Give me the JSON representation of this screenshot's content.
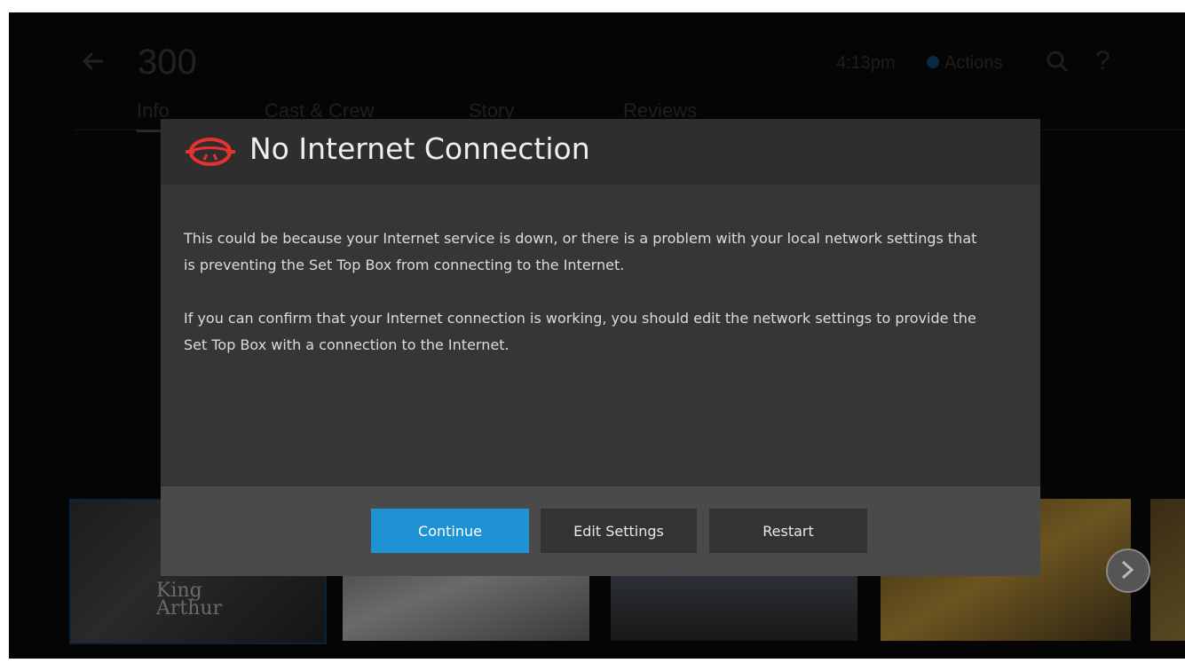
{
  "background": {
    "title": "300",
    "time": "4:13pm",
    "actions_label": "Actions",
    "tabs": [
      {
        "label": "Info",
        "active": true
      },
      {
        "label": "Cast & Crew",
        "active": false
      },
      {
        "label": "Story",
        "active": false
      },
      {
        "label": "Reviews",
        "active": false
      }
    ],
    "tile_1_text_line1": "King",
    "tile_1_text_line2": "Arthur",
    "icons": [
      "back-arrow-icon",
      "search-icon",
      "help-icon",
      "chevron-right-icon"
    ]
  },
  "dialog": {
    "title": "No Internet Connection",
    "icon": "disconnected-globe-icon",
    "icon_color": "#e8312e",
    "paragraphs": [
      "This could be because your Internet service is down, or there is a problem with your local network settings that is preventing the Set Top Box from connecting to the Internet.",
      "If you can confirm that your Internet connection is working, you should edit the network settings to provide the Set Top Box with a connection to the Internet."
    ],
    "buttons": {
      "continue": "Continue",
      "edit_settings": "Edit Settings",
      "restart": "Restart"
    },
    "accent_color": "#1f92d4"
  }
}
